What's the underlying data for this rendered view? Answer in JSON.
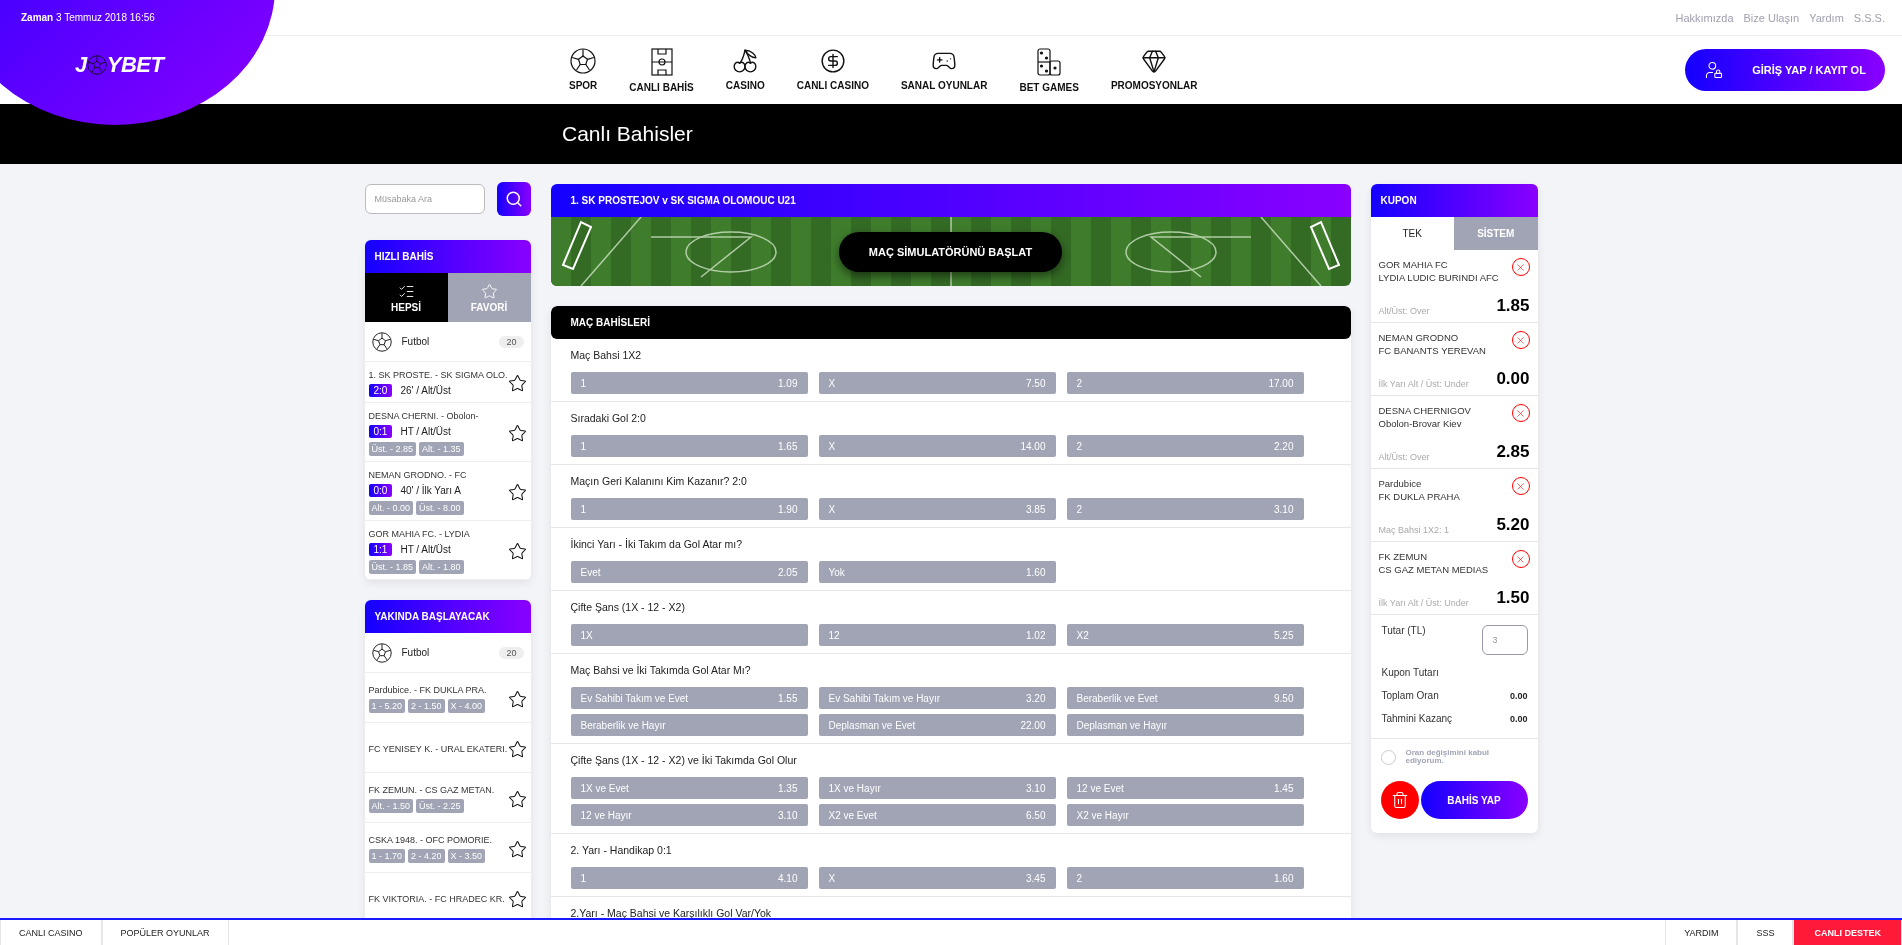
{
  "top_bar": {
    "time_label": "Zaman",
    "time_value": "3 Temmuz 2018 16:56",
    "links": [
      "Hakkımızda",
      "Bize Ulaşın",
      "Yardım",
      "S.S.S."
    ]
  },
  "logo": {
    "before": "J",
    "after": "YBET"
  },
  "nav": [
    {
      "label": "SPOR",
      "kind": "ball"
    },
    {
      "label": "CANLI BAHİS",
      "kind": "field"
    },
    {
      "label": "CASINO",
      "kind": "slot"
    },
    {
      "label": "CANLI CASINO",
      "kind": "chip"
    },
    {
      "label": "SANAL OYUNLAR",
      "kind": "gamepad"
    },
    {
      "label": "BET GAMES",
      "kind": "domino"
    },
    {
      "label": "PROMOSYONLAR",
      "kind": "diamond"
    }
  ],
  "login_button": "GİRİŞ YAP / KAYIT OL",
  "page_title": "Canlı Bahisler",
  "search": {
    "placeholder": "Müsabaka Ara"
  },
  "quick_bets": {
    "title": "HIZLI BAHİS",
    "tabs": [
      {
        "label": "HEPSİ",
        "kind": "all",
        "selected": true
      },
      {
        "label": "FAVORİ",
        "kind": "fav",
        "selected": false
      }
    ],
    "sport": {
      "name": "Futbol",
      "count": "20"
    },
    "matches": [
      {
        "teams": "1. SK PROSTE. - SK SIGMA OLO.",
        "score": "2:0",
        "info": "26' / Alt/Üst"
      },
      {
        "teams": "DESNA CHERNI. - Obolon-",
        "score": "0:1",
        "info": "HT / Alt/Üst",
        "odds": [
          "Üst. - 2.85",
          "Alt. - 1.35"
        ]
      },
      {
        "teams": "NEMAN GRODNO. - FC",
        "score": "0:0",
        "info": "40' / İlk Yarı A",
        "odds": [
          "Alt. - 0.00",
          "Üst. - 8.00"
        ]
      },
      {
        "teams": "GOR MAHIA FC. - LYDIA",
        "score": "1:1",
        "info": "HT / Alt/Üst",
        "odds": [
          "Üst. - 1.85",
          "Alt. - 1.80"
        ]
      }
    ]
  },
  "upcoming": {
    "title": "YAKINDA BAŞLAYACAK",
    "sport": {
      "name": "Futbol",
      "count": "20"
    },
    "matches": [
      {
        "teams": "Pardubice. - FK DUKLA PRA.",
        "odds": [
          "1 - 5.20",
          "2 - 1.50",
          "X - 4.00"
        ]
      },
      {
        "teams": "FC YENISEY K. - URAL EKATERI."
      },
      {
        "teams": "FK ZEMUN. - CS GAZ METAN.",
        "odds": [
          "Alt. - 1.50",
          "Üst. - 2.25"
        ]
      },
      {
        "teams": "CSKA 1948. - OFC POMORIE.",
        "odds": [
          "1 - 1.70",
          "2 - 4.20",
          "X - 3.50"
        ]
      },
      {
        "teams": "FK VIKTORIA. - FC HRADEC KR."
      }
    ]
  },
  "match": {
    "title": "1. SK PROSTEJOV v SK SIGMA OLOMOUC U21",
    "sim_button": "MAÇ SİMULATÖRÜNÜ BAŞLAT"
  },
  "markets_title": "MAÇ BAHİSLERİ",
  "markets": [
    {
      "title": "Maç Bahsi 1X2",
      "options": [
        {
          "label": "1",
          "odd": "1.09"
        },
        {
          "label": "X",
          "odd": "7.50"
        },
        {
          "label": "2",
          "odd": "17.00"
        }
      ]
    },
    {
      "title": "Sıradaki Gol 2:0",
      "options": [
        {
          "label": "1",
          "odd": "1.65"
        },
        {
          "label": "X",
          "odd": "14.00"
        },
        {
          "label": "2",
          "odd": "2.20"
        }
      ]
    },
    {
      "title": "Maçın Geri Kalanını Kim Kazanır? 2:0",
      "options": [
        {
          "label": "1",
          "odd": "1.90"
        },
        {
          "label": "X",
          "odd": "3.85"
        },
        {
          "label": "2",
          "odd": "3.10"
        }
      ]
    },
    {
      "title": "İkinci Yarı - İki Takım da Gol Atar mı?",
      "options": [
        {
          "label": "Evet",
          "odd": "2.05"
        },
        {
          "label": "Yok",
          "odd": "1.60"
        }
      ]
    },
    {
      "title": "Çifte Şans (1X - 12 - X2)",
      "options": [
        {
          "label": "1X"
        },
        {
          "label": "12",
          "odd": "1.02"
        },
        {
          "label": "X2",
          "odd": "5.25"
        }
      ]
    },
    {
      "title": "Maç Bahsi ve İki Takımda Gol Atar Mı?",
      "options": [
        {
          "label": "Ev Sahibi Takım ve Evet",
          "odd": "1.55"
        },
        {
          "label": "Ev Sahibi Takım ve Hayır",
          "odd": "3.20"
        },
        {
          "label": "Beraberlik ve Evet",
          "odd": "9.50"
        },
        {
          "label": "Beraberlik ve Hayır"
        },
        {
          "label": "Deplasman ve Evet",
          "odd": "22.00"
        },
        {
          "label": "Deplasman ve Hayır"
        }
      ]
    },
    {
      "title": "Çifte Şans (1X - 12 - X2) ve İki Takımda Gol Olur",
      "options": [
        {
          "label": "1X ve Evet",
          "odd": "1.35"
        },
        {
          "label": "1X ve Hayır",
          "odd": "3.10"
        },
        {
          "label": "12 ve Evet",
          "odd": "1.45"
        },
        {
          "label": "12 ve Hayır",
          "odd": "3.10"
        },
        {
          "label": "X2 ve Evet",
          "odd": "6.50"
        },
        {
          "label": "X2 ve Hayır"
        }
      ]
    },
    {
      "title": "2. Yarı - Handikap 0:1",
      "options": [
        {
          "label": "1",
          "odd": "4.10"
        },
        {
          "label": "X",
          "odd": "3.45"
        },
        {
          "label": "2",
          "odd": "1.60"
        }
      ]
    },
    {
      "title": "2.Yarı - Maç Bahsi ve Karşılıklı Gol Var/Yok"
    }
  ],
  "coupon": {
    "title": "KUPON",
    "tabs": [
      {
        "label": "TEK",
        "selected": true
      },
      {
        "label": "SİSTEM",
        "selected": false
      }
    ],
    "items": [
      {
        "teams": [
          "GOR MAHIA FC",
          "LYDIA LUDIC BURINDI AFC"
        ],
        "market": "Alt/Üst: Over",
        "odd": "1.85"
      },
      {
        "teams": [
          "NEMAN GRODNO",
          "FC BANANTS YEREVAN"
        ],
        "market": "İlk Yarı Alt / Üst: Under",
        "odd": "0.00"
      },
      {
        "teams": [
          "DESNA CHERNIGOV",
          "Obolon-Brovar Kiev"
        ],
        "market": "Alt/Üst: Over",
        "odd": "2.85"
      },
      {
        "teams": [
          "Pardubice",
          "FK DUKLA PRAHA"
        ],
        "market": "Maç Bahsi 1X2: 1",
        "odd": "5.20"
      },
      {
        "teams": [
          "FK ZEMUN",
          "CS GAZ METAN MEDIAS"
        ],
        "market": "İlk Yarı Alt / Üst: Under",
        "odd": "1.50"
      }
    ],
    "stake_label": "Tutar (TL)",
    "stake_placeholder": "3",
    "summary": [
      {
        "label": "Kupon Tutarı"
      },
      {
        "label": "Toplam Oran",
        "value": "0.00"
      },
      {
        "label": "Tahmini Kazanç",
        "value": "0.00"
      }
    ],
    "accept": {
      "label": "Oran değişimini kabul ediyorum.",
      "checked": false
    },
    "submit": "BAHİS YAP"
  },
  "footer": {
    "left": [
      "CANLI CASINO",
      "POPÜLER OYUNLAR"
    ],
    "right": [
      {
        "label": "YARDIM",
        "kind": "plain"
      },
      {
        "label": "SSS",
        "kind": "plain"
      },
      {
        "label": "CANLI DESTEK",
        "kind": "highlight"
      }
    ]
  }
}
